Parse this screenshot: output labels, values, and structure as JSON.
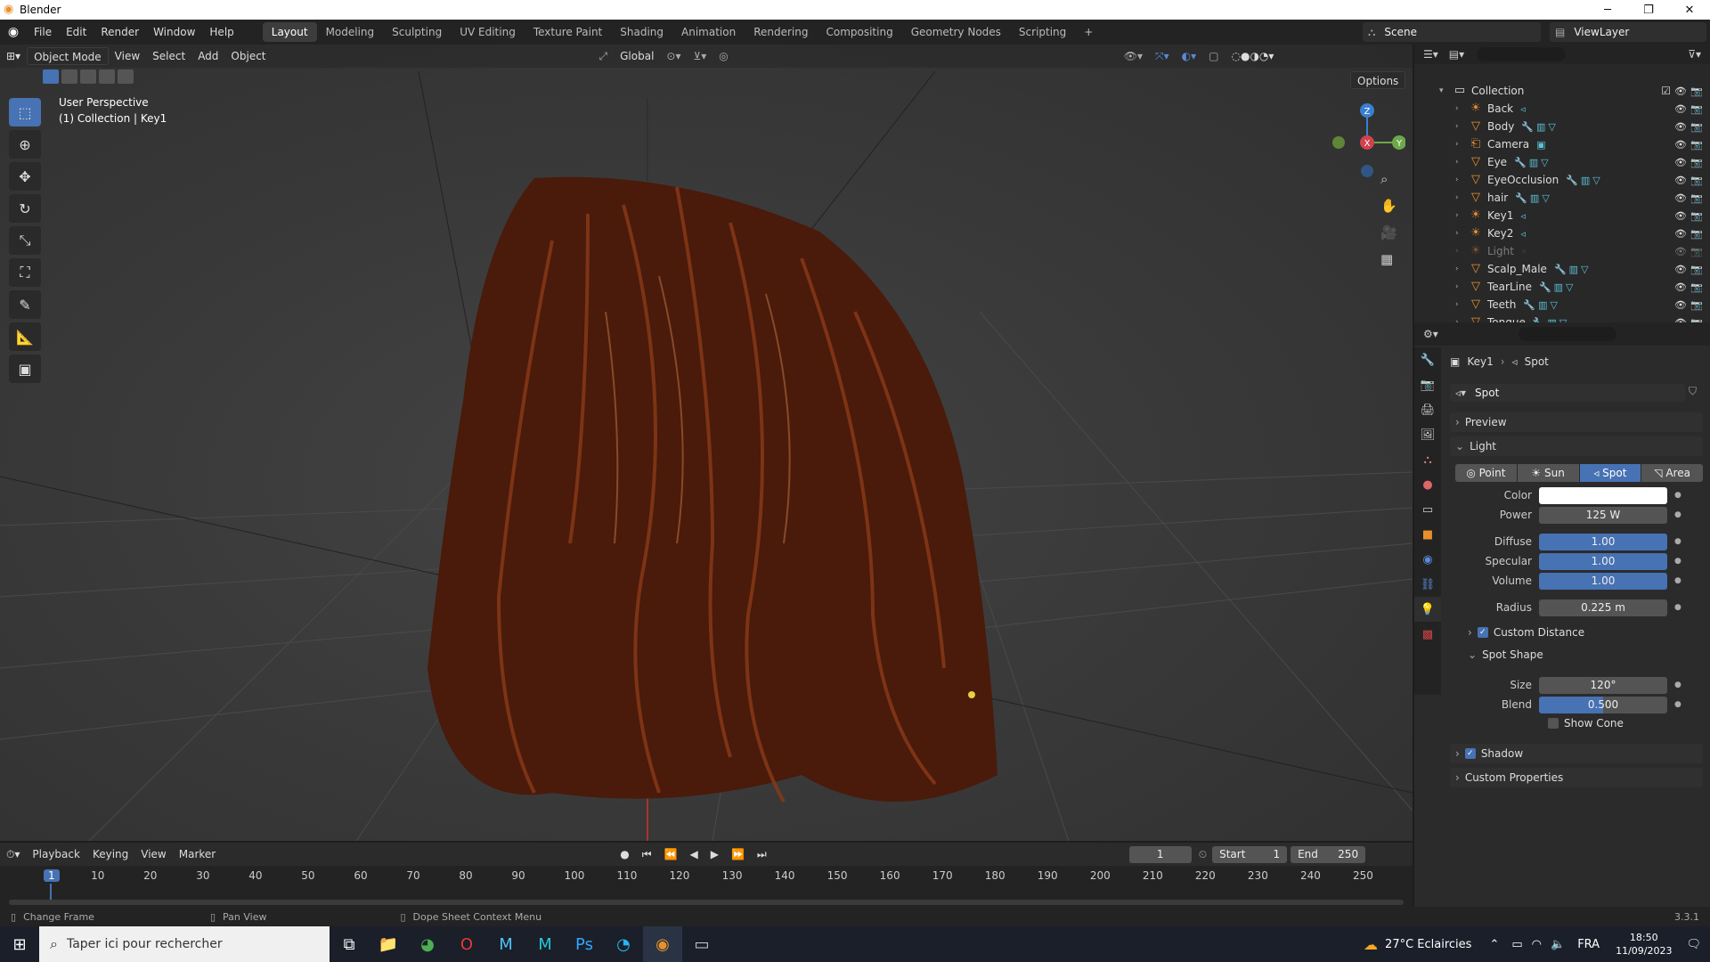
{
  "window": {
    "title": "Blender",
    "min": "─",
    "max": "❐",
    "close": "✕"
  },
  "menu": [
    "File",
    "Edit",
    "Render",
    "Window",
    "Help"
  ],
  "workspaces": [
    "Layout",
    "Modeling",
    "Sculpting",
    "UV Editing",
    "Texture Paint",
    "Shading",
    "Animation",
    "Rendering",
    "Compositing",
    "Geometry Nodes",
    "Scripting"
  ],
  "add_tab": "+",
  "scene": {
    "name": "Scene",
    "view_layer": "ViewLayer"
  },
  "viewport": {
    "mode": "Object Mode",
    "menus": [
      "View",
      "Select",
      "Add",
      "Object"
    ],
    "orientation": "Global",
    "options": "Options",
    "perspective": "User Perspective",
    "context": "(1) Collection | Key1",
    "gizmo": {
      "z": "Z",
      "y": "Y",
      "x": "X"
    }
  },
  "outliner": {
    "collection": "Collection",
    "items": [
      {
        "name": "Back",
        "icon": "light-icon",
        "mods": "◃"
      },
      {
        "name": "Body",
        "icon": "mesh-icon",
        "mods": "🔧▥▽"
      },
      {
        "name": "Camera",
        "icon": "camera-icon",
        "mods": "▣"
      },
      {
        "name": "Eye",
        "icon": "mesh-icon",
        "mods": "🔧▥▽"
      },
      {
        "name": "EyeOcclusion",
        "icon": "mesh-icon",
        "mods": "🔧▥▽"
      },
      {
        "name": "hair",
        "icon": "mesh-icon",
        "mods": "🔧▥▽"
      },
      {
        "name": "Key1",
        "icon": "light-icon",
        "mods": "◃"
      },
      {
        "name": "Key2",
        "icon": "light-icon",
        "mods": "◃"
      },
      {
        "name": "Light",
        "icon": "light-icon",
        "mods": "◦"
      },
      {
        "name": "Scalp_Male",
        "icon": "mesh-icon",
        "mods": "🔧▥▽"
      },
      {
        "name": "TearLine",
        "icon": "mesh-icon",
        "mods": "🔧▥▽"
      },
      {
        "name": "Teeth",
        "icon": "mesh-icon",
        "mods": "🔧▥▽"
      },
      {
        "name": "Tongue",
        "icon": "mesh-icon",
        "mods": "🔧▥▽"
      }
    ]
  },
  "properties": {
    "breadcrumb_object": "Key1",
    "breadcrumb_data": "Spot",
    "datablock": "Spot",
    "preview": "Preview",
    "light": "Light",
    "types": [
      "Point",
      "Sun",
      "Spot",
      "Area"
    ],
    "active_type_index": 2,
    "color_label": "Color",
    "color_value": "#ffffff",
    "power_label": "Power",
    "power": "125 W",
    "diffuse_label": "Diffuse",
    "diffuse": "1.00",
    "specular_label": "Specular",
    "specular": "1.00",
    "volume_label": "Volume",
    "volume": "1.00",
    "radius_label": "Radius",
    "radius": "0.225 m",
    "custom_distance": "Custom Distance",
    "spot_shape": "Spot Shape",
    "size_label": "Size",
    "size": "120°",
    "blend_label": "Blend",
    "blend": "0.500",
    "blend_fraction": 0.5,
    "show_cone": "Show Cone",
    "shadow": "Shadow",
    "custom_properties": "Custom Properties"
  },
  "timeline": {
    "menus": [
      "Playback",
      "Keying",
      "View",
      "Marker"
    ],
    "current_frame": "1",
    "start_label": "Start",
    "start": "1",
    "end_label": "End",
    "end": "250",
    "ticks": [
      "1",
      "10",
      "20",
      "30",
      "40",
      "50",
      "60",
      "70",
      "80",
      "90",
      "100",
      "110",
      "120",
      "130",
      "140",
      "150",
      "160",
      "170",
      "180",
      "190",
      "200",
      "210",
      "220",
      "230",
      "240",
      "250"
    ]
  },
  "status": {
    "change_frame": "Change Frame",
    "pan_view": "Pan View",
    "context_menu": "Dope Sheet Context Menu",
    "version": "3.3.1"
  },
  "taskbar": {
    "search": "Taper ici pour rechercher",
    "weather": "27°C Eclaircies",
    "lang": "FRA",
    "time": "18:50",
    "date": "11/09/2023"
  },
  "colors": {
    "accent": "#4772b3",
    "orange": "#e8902c",
    "hair": "#6b2a12"
  }
}
